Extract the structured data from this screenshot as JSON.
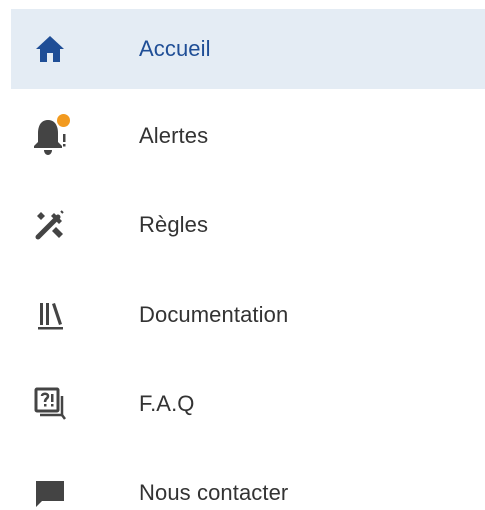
{
  "colors": {
    "accent": "#1f4e96",
    "active_background": "#e4ecf4",
    "icon_gray": "#444444",
    "text": "#333333",
    "notification_dot": "#f29a1f"
  },
  "nav": {
    "active_index": 0,
    "items": [
      {
        "label": "Accueil",
        "icon": "home-icon",
        "active": true
      },
      {
        "label": "Alertes",
        "icon": "bell-icon",
        "has_notification": true
      },
      {
        "label": "Règles",
        "icon": "tools-icon"
      },
      {
        "label": "Documentation",
        "icon": "library-icon"
      },
      {
        "label": "F.A.Q",
        "icon": "faq-icon"
      },
      {
        "label": "Nous contacter",
        "icon": "chat-icon"
      }
    ]
  }
}
